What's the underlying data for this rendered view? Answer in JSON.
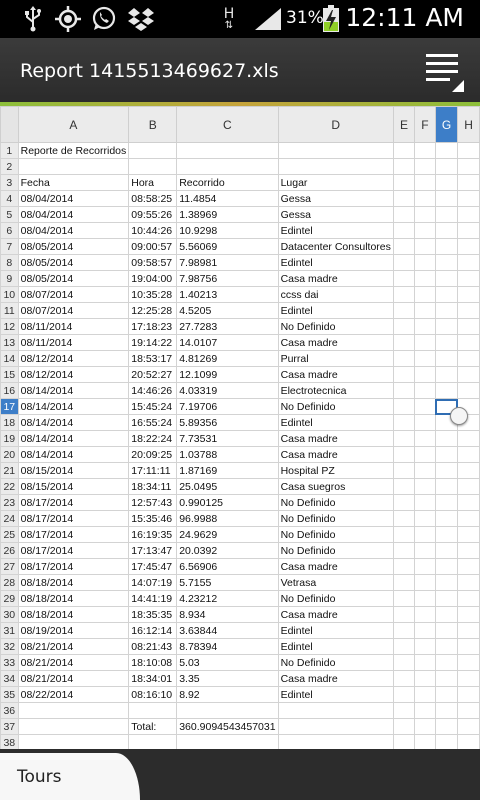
{
  "status_bar": {
    "icons": [
      "usb-icon",
      "gps-icon",
      "whatsapp-icon",
      "dropbox-icon",
      "network-h-icon",
      "signal-icon",
      "battery-charging-icon"
    ],
    "network_label": "H",
    "battery_percent": "31%",
    "time": "12:11 AM"
  },
  "title_bar": {
    "title": "Report 1415513469627.xls",
    "menu_icon": "menu-icon"
  },
  "sheet": {
    "columns": [
      "A",
      "B",
      "C",
      "D",
      "E",
      "F",
      "G",
      "H"
    ],
    "selected_column": "G",
    "selected_row": "17",
    "rows": [
      {
        "n": "1",
        "a": "Reporte de Recorridos",
        "b": "",
        "c": "",
        "d": ""
      },
      {
        "n": "2",
        "a": "",
        "b": "",
        "c": "",
        "d": ""
      },
      {
        "n": "3",
        "a": "Fecha",
        "b": "Hora",
        "c": "Recorrido",
        "d": "Lugar"
      },
      {
        "n": "4",
        "a": "08/04/2014",
        "b": "08:58:25",
        "c": "11.4854",
        "d": "Gessa"
      },
      {
        "n": "5",
        "a": "08/04/2014",
        "b": "09:55:26",
        "c": "1.38969",
        "d": "Gessa"
      },
      {
        "n": "6",
        "a": "08/04/2014",
        "b": "10:44:26",
        "c": "10.9298",
        "d": "Edintel"
      },
      {
        "n": "7",
        "a": "08/05/2014",
        "b": "09:00:57",
        "c": "5.56069",
        "d": "Datacenter Consultores"
      },
      {
        "n": "8",
        "a": "08/05/2014",
        "b": "09:58:57",
        "c": "7.98981",
        "d": "Edintel"
      },
      {
        "n": "9",
        "a": "08/05/2014",
        "b": "19:04:00",
        "c": "7.98756",
        "d": "Casa madre"
      },
      {
        "n": "10",
        "a": "08/07/2014",
        "b": "10:35:28",
        "c": "1.40213",
        "d": "ccss dai"
      },
      {
        "n": "11",
        "a": "08/07/2014",
        "b": "12:25:28",
        "c": "4.5205",
        "d": "Edintel"
      },
      {
        "n": "12",
        "a": "08/11/2014",
        "b": "17:18:23",
        "c": "27.7283",
        "d": "No Definido"
      },
      {
        "n": "13",
        "a": "08/11/2014",
        "b": "19:14:22",
        "c": "14.0107",
        "d": "Casa madre"
      },
      {
        "n": "14",
        "a": "08/12/2014",
        "b": "18:53:17",
        "c": "4.81269",
        "d": "Purral"
      },
      {
        "n": "15",
        "a": "08/12/2014",
        "b": "20:52:27",
        "c": "12.1099",
        "d": "Casa madre"
      },
      {
        "n": "16",
        "a": "08/14/2014",
        "b": "14:46:26",
        "c": "4.03319",
        "d": "Electrotecnica"
      },
      {
        "n": "17",
        "a": "08/14/2014",
        "b": "15:45:24",
        "c": "7.19706",
        "d": "No Definido"
      },
      {
        "n": "18",
        "a": "08/14/2014",
        "b": "16:55:24",
        "c": "5.89356",
        "d": "Edintel"
      },
      {
        "n": "19",
        "a": "08/14/2014",
        "b": "18:22:24",
        "c": "7.73531",
        "d": "Casa madre"
      },
      {
        "n": "20",
        "a": "08/14/2014",
        "b": "20:09:25",
        "c": "1.03788",
        "d": "Casa madre"
      },
      {
        "n": "21",
        "a": "08/15/2014",
        "b": "17:11:11",
        "c": "1.87169",
        "d": "Hospital PZ"
      },
      {
        "n": "22",
        "a": "08/15/2014",
        "b": "18:34:11",
        "c": "25.0495",
        "d": "Casa suegros"
      },
      {
        "n": "23",
        "a": "08/17/2014",
        "b": "12:57:43",
        "c": "0.990125",
        "d": "No Definido"
      },
      {
        "n": "24",
        "a": "08/17/2014",
        "b": "15:35:46",
        "c": "96.9988",
        "d": "No Definido"
      },
      {
        "n": "25",
        "a": "08/17/2014",
        "b": "16:19:35",
        "c": "24.9629",
        "d": "No Definido"
      },
      {
        "n": "26",
        "a": "08/17/2014",
        "b": "17:13:47",
        "c": "20.0392",
        "d": "No Definido"
      },
      {
        "n": "27",
        "a": "08/17/2014",
        "b": "17:45:47",
        "c": "6.56906",
        "d": "Casa madre"
      },
      {
        "n": "28",
        "a": "08/18/2014",
        "b": "14:07:19",
        "c": "5.7155",
        "d": "Vetrasa"
      },
      {
        "n": "29",
        "a": "08/18/2014",
        "b": "14:41:19",
        "c": "4.23212",
        "d": "No Definido"
      },
      {
        "n": "30",
        "a": "08/18/2014",
        "b": "18:35:35",
        "c": "8.934",
        "d": "Casa madre"
      },
      {
        "n": "31",
        "a": "08/19/2014",
        "b": "16:12:14",
        "c": "3.63844",
        "d": "Edintel"
      },
      {
        "n": "32",
        "a": "08/21/2014",
        "b": "08:21:43",
        "c": "8.78394",
        "d": "Edintel"
      },
      {
        "n": "33",
        "a": "08/21/2014",
        "b": "18:10:08",
        "c": "5.03",
        "d": "No Definido"
      },
      {
        "n": "34",
        "a": "08/21/2014",
        "b": "18:34:01",
        "c": "3.35",
        "d": "Casa madre"
      },
      {
        "n": "35",
        "a": "08/22/2014",
        "b": "08:16:10",
        "c": "8.92",
        "d": "Edintel"
      },
      {
        "n": "36",
        "a": "",
        "b": "",
        "c": "",
        "d": ""
      },
      {
        "n": "37",
        "a": "",
        "b": "Total:",
        "c": "360.9094543457031",
        "d": ""
      },
      {
        "n": "38",
        "a": "",
        "b": "",
        "c": "",
        "d": ""
      }
    ]
  },
  "tabs": {
    "active": "Tours"
  }
}
